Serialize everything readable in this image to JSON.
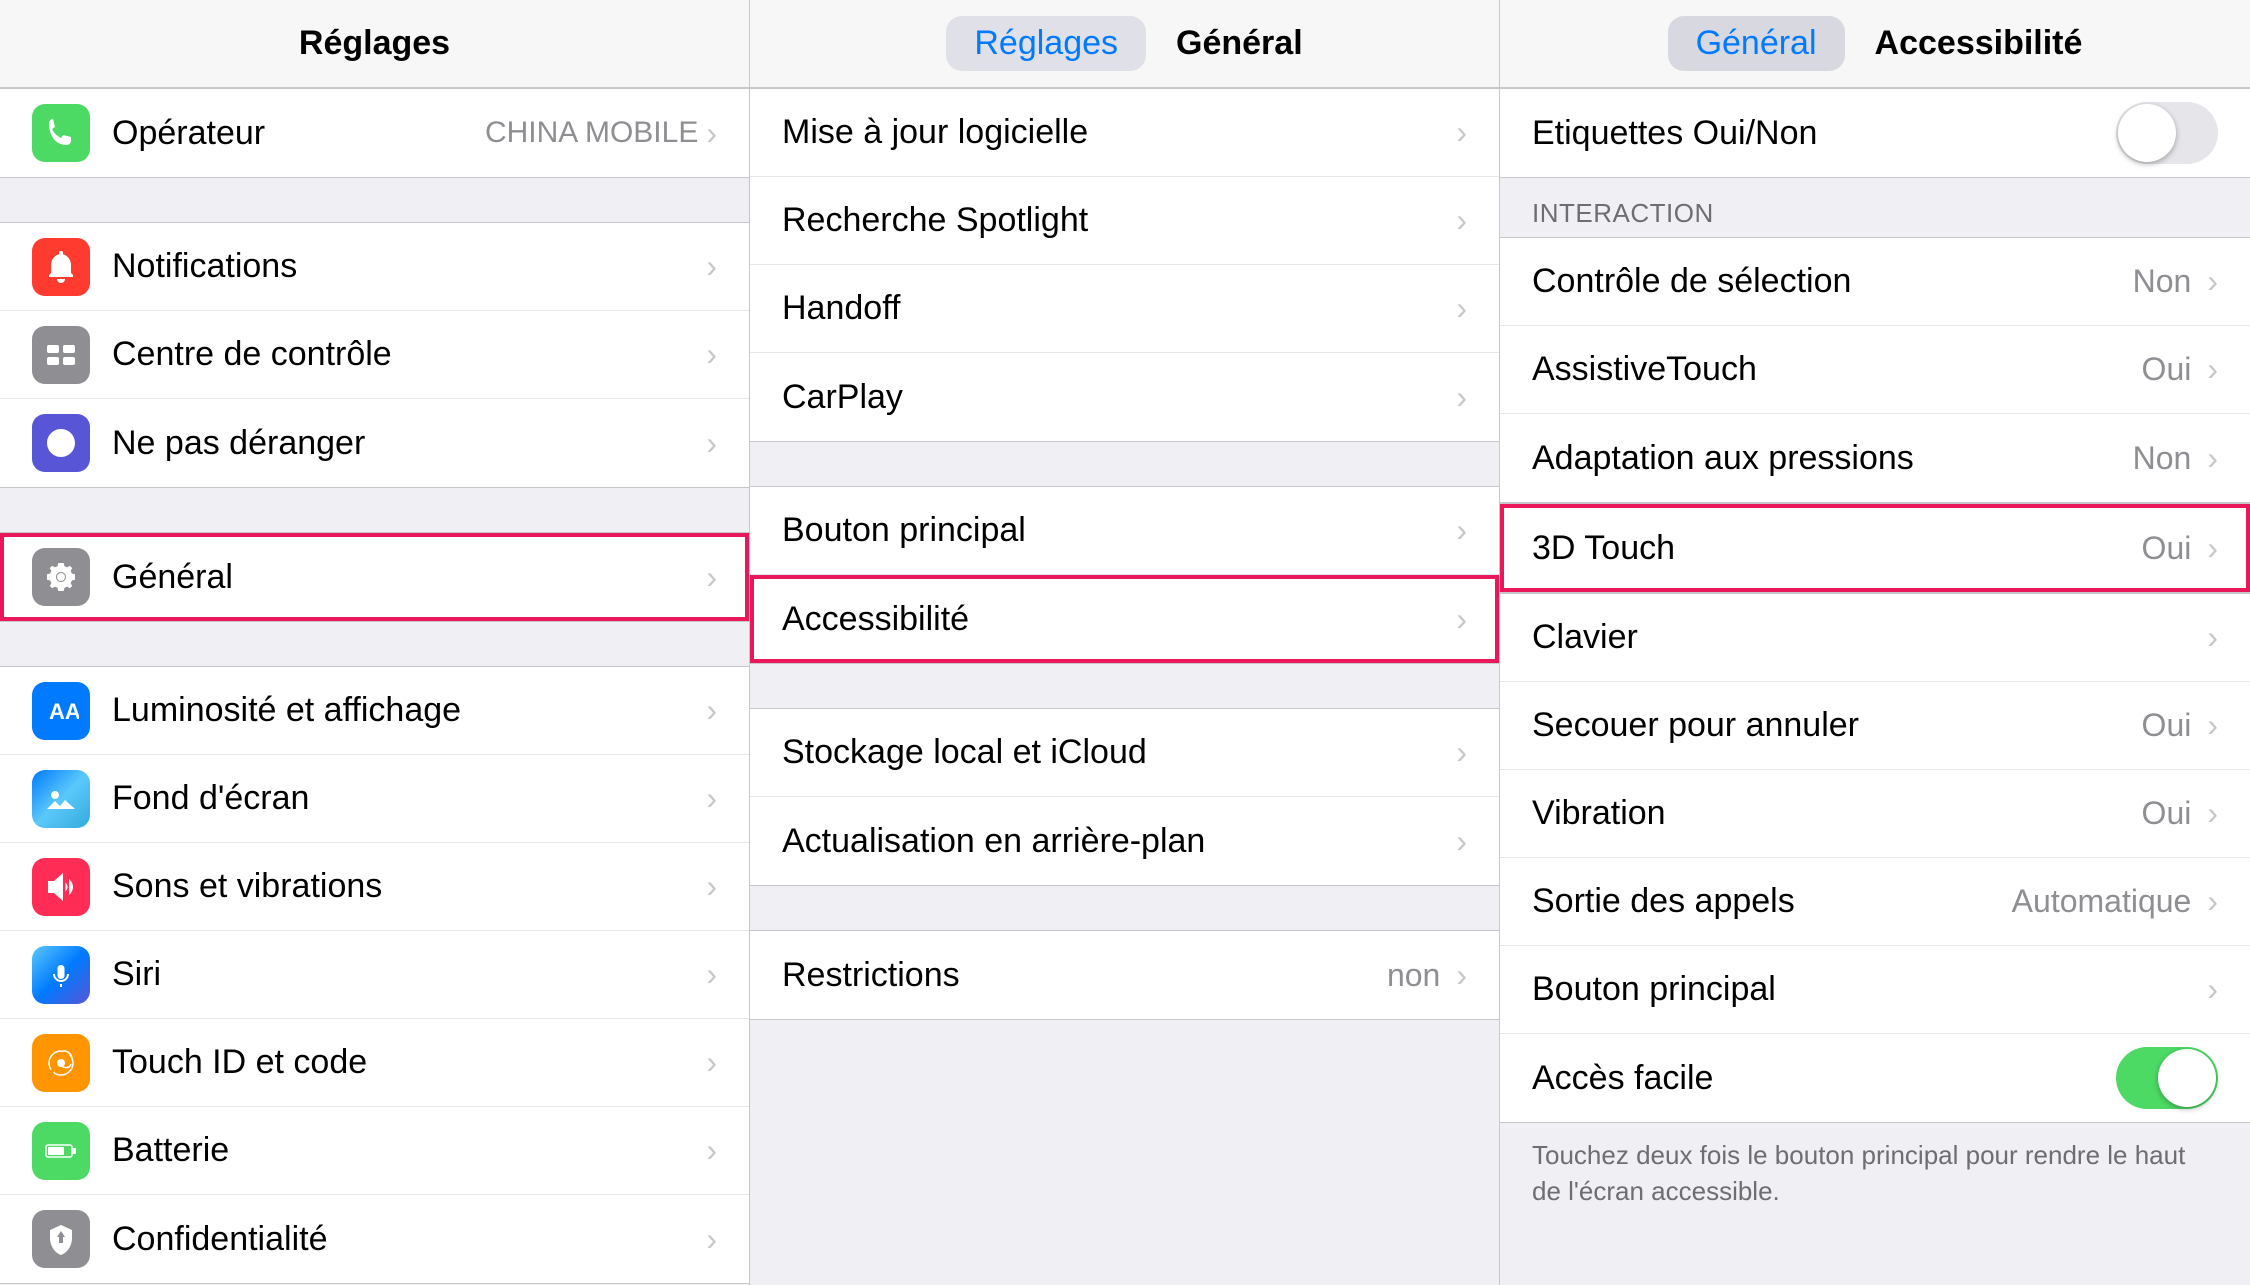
{
  "nav": {
    "col1_title": "Réglages",
    "col2_back": "Réglages",
    "col2_title": "Général",
    "col3_back": "Général",
    "col3_title": "Accessibilité"
  },
  "col1": {
    "items": [
      {
        "id": "operateur",
        "icon": "phone",
        "iconBg": "#4cd964",
        "label": "Opérateur",
        "value": "CHINA MOBILE",
        "hasChevron": true
      },
      {
        "id": "notifications",
        "icon": "bell",
        "iconBg": "#ff3b30",
        "label": "Notifications",
        "hasChevron": true
      },
      {
        "id": "centre-controle",
        "icon": "control",
        "iconBg": "#8e8e93",
        "label": "Centre de contrôle",
        "hasChevron": true
      },
      {
        "id": "ne-pas-deranger",
        "icon": "moon",
        "iconBg": "#5856d6",
        "label": "Ne pas déranger",
        "hasChevron": true
      },
      {
        "id": "general",
        "icon": "gear",
        "iconBg": "#8e8e93",
        "label": "Général",
        "hasChevron": true,
        "highlighted": true
      },
      {
        "id": "luminosite",
        "icon": "aa",
        "iconBg": "#007aff",
        "label": "Luminosité et affichage",
        "hasChevron": true
      },
      {
        "id": "fond-ecran",
        "icon": "flower",
        "iconBg": "#007aff",
        "label": "Fond d'écran",
        "hasChevron": true
      },
      {
        "id": "sons",
        "icon": "speaker",
        "iconBg": "#ff2d55",
        "label": "Sons et vibrations",
        "hasChevron": true
      },
      {
        "id": "siri",
        "icon": "siri",
        "iconBg": "#007aff",
        "label": "Siri",
        "hasChevron": true
      },
      {
        "id": "touch-id",
        "icon": "fingerprint",
        "iconBg": "#ff9500",
        "label": "Touch ID et code",
        "hasChevron": true
      },
      {
        "id": "batterie",
        "icon": "battery",
        "iconBg": "#4cd964",
        "label": "Batterie",
        "hasChevron": true
      },
      {
        "id": "confidentialite",
        "icon": "hand",
        "iconBg": "#8e8e93",
        "label": "Confidentialité",
        "hasChevron": true
      }
    ]
  },
  "col2": {
    "items": [
      {
        "id": "maj-logicielle",
        "label": "Mise à jour logicielle",
        "hasChevron": true
      },
      {
        "id": "recherche-spotlight",
        "label": "Recherche Spotlight",
        "hasChevron": true
      },
      {
        "id": "handoff",
        "label": "Handoff",
        "hasChevron": true
      },
      {
        "id": "carplay",
        "label": "CarPlay",
        "hasChevron": true
      },
      {
        "id": "bouton-principal",
        "label": "Bouton principal",
        "hasChevron": true
      },
      {
        "id": "accessibilite",
        "label": "Accessibilité",
        "hasChevron": true,
        "highlighted": true
      },
      {
        "id": "stockage-icloud",
        "label": "Stockage local et iCloud",
        "hasChevron": true
      },
      {
        "id": "actualisation",
        "label": "Actualisation en arrière-plan",
        "hasChevron": true
      },
      {
        "id": "restrictions",
        "label": "Restrictions",
        "value": "non",
        "hasChevron": true
      }
    ],
    "groups": [
      {
        "items": [
          "maj-logicielle",
          "recherche-spotlight",
          "handoff",
          "carplay"
        ]
      },
      {
        "items": [
          "bouton-principal",
          "accessibilite"
        ]
      },
      {
        "items": [
          "stockage-icloud",
          "actualisation"
        ]
      },
      {
        "items": [
          "restrictions"
        ]
      }
    ]
  },
  "col3": {
    "top_items": [
      {
        "id": "etiquettes",
        "label": "Etiquettes Oui/Non",
        "hasToggle": true,
        "toggleOn": false
      }
    ],
    "section_interaction": "INTERACTION",
    "interaction_items": [
      {
        "id": "controle-selection",
        "label": "Contrôle de sélection",
        "value": "Non",
        "hasChevron": true
      },
      {
        "id": "assistive-touch",
        "label": "AssistiveTouch",
        "value": "Oui",
        "hasChevron": true
      },
      {
        "id": "adaptation-pressions",
        "label": "Adaptation aux pressions",
        "value": "Non",
        "hasChevron": true
      }
    ],
    "highlight_item": {
      "id": "3d-touch",
      "label": "3D Touch",
      "value": "Oui",
      "hasChevron": true,
      "highlighted": true
    },
    "bottom_items": [
      {
        "id": "clavier",
        "label": "Clavier",
        "hasChevron": true
      },
      {
        "id": "secouer",
        "label": "Secouer pour annuler",
        "value": "Oui",
        "hasChevron": true
      },
      {
        "id": "vibration",
        "label": "Vibration",
        "value": "Oui",
        "hasChevron": true
      },
      {
        "id": "sortie-appels",
        "label": "Sortie des appels",
        "value": "Automatique",
        "hasChevron": true
      },
      {
        "id": "bouton-principal",
        "label": "Bouton principal",
        "hasChevron": true
      },
      {
        "id": "acces-facile",
        "label": "Accès facile",
        "hasToggle": true,
        "toggleOn": true
      }
    ],
    "footer": "Touchez deux fois le bouton principal pour rendre le haut de l'écran accessible."
  }
}
